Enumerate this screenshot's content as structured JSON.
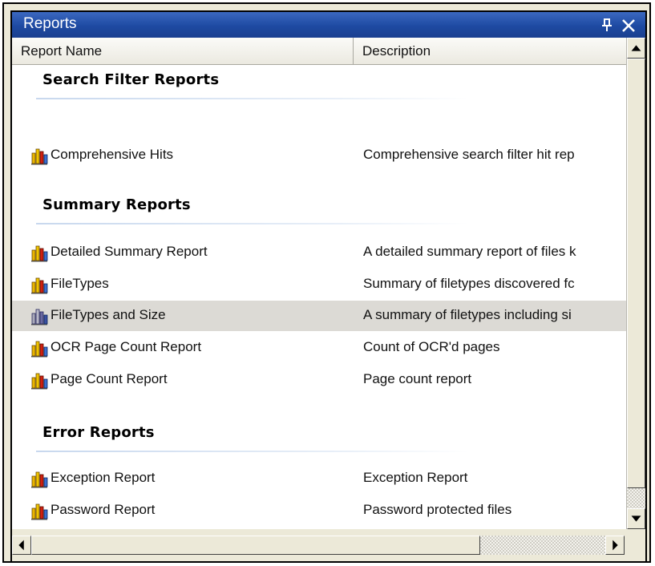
{
  "window": {
    "title": "Reports",
    "pin_icon": "pin-icon",
    "close_icon": "close-icon"
  },
  "columns": {
    "name": "Report Name",
    "description": "Description"
  },
  "groups": [
    {
      "title": "Search Filter Reports",
      "rows": [
        {
          "name": "Comprehensive Hits",
          "description": "Comprehensive search filter hit rep",
          "icon": "report-chart-icon"
        }
      ]
    },
    {
      "title": "Summary Reports",
      "rows": [
        {
          "name": "Detailed Summary Report",
          "description": "A detailed summary report of files k",
          "icon": "report-chart-icon"
        },
        {
          "name": "FileTypes",
          "description": "Summary of filetypes discovered fc",
          "icon": "report-chart-icon"
        },
        {
          "name": "FileTypes and Size",
          "description": "A summary of filetypes including si",
          "icon": "report-chart-icon",
          "selected": true
        },
        {
          "name": "OCR Page Count Report",
          "description": "Count of OCR'd pages",
          "icon": "report-chart-icon"
        },
        {
          "name": "Page Count Report",
          "description": "Page count report",
          "icon": "report-chart-icon"
        }
      ]
    },
    {
      "title": "Error Reports",
      "rows": [
        {
          "name": "Exception Report",
          "description": "Exception Report",
          "icon": "report-chart-icon"
        },
        {
          "name": "Password Report",
          "description": "Password protected files",
          "icon": "report-chart-icon"
        }
      ]
    }
  ],
  "colors": {
    "titlebar": "#1e4aa2",
    "selected_row": "#dcdad5",
    "chrome": "#ece9d8"
  }
}
